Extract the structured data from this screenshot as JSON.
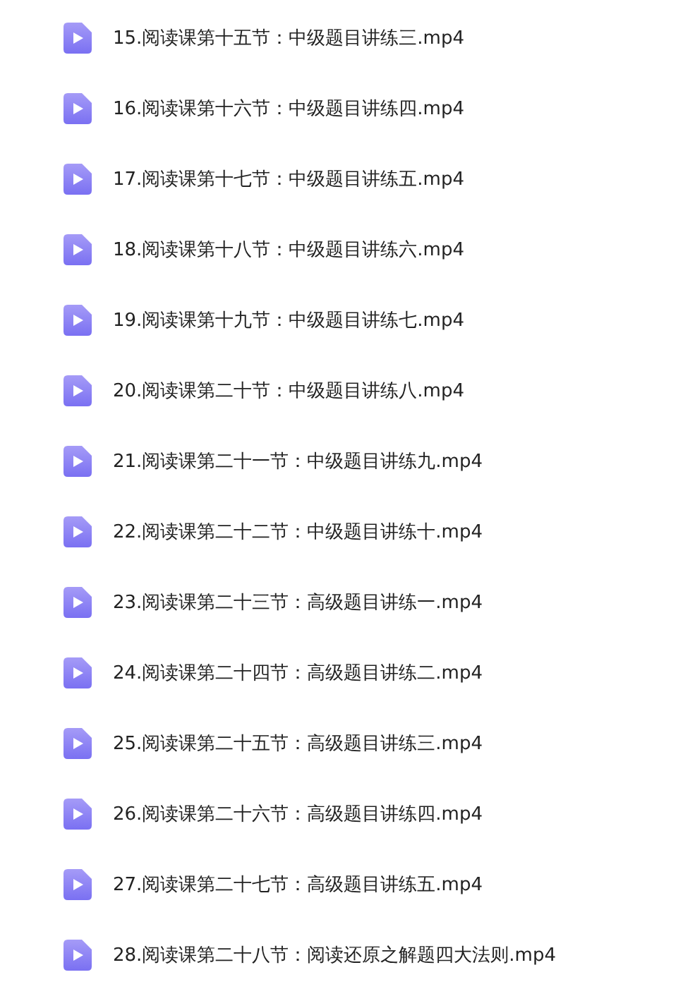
{
  "files": [
    {
      "name": "15.阅读课第十五节：中级题目讲练三.mp4"
    },
    {
      "name": "16.阅读课第十六节：中级题目讲练四.mp4"
    },
    {
      "name": "17.阅读课第十七节：中级题目讲练五.mp4"
    },
    {
      "name": "18.阅读课第十八节：中级题目讲练六.mp4"
    },
    {
      "name": "19.阅读课第十九节：中级题目讲练七.mp4"
    },
    {
      "name": "20.阅读课第二十节：中级题目讲练八.mp4"
    },
    {
      "name": "21.阅读课第二十一节：中级题目讲练九.mp4"
    },
    {
      "name": "22.阅读课第二十二节：中级题目讲练十.mp4"
    },
    {
      "name": "23.阅读课第二十三节：高级题目讲练一.mp4"
    },
    {
      "name": "24.阅读课第二十四节：高级题目讲练二.mp4"
    },
    {
      "name": "25.阅读课第二十五节：高级题目讲练三.mp4"
    },
    {
      "name": "26.阅读课第二十六节：高级题目讲练四.mp4"
    },
    {
      "name": "27.阅读课第二十七节：高级题目讲练五.mp4"
    },
    {
      "name": "28.阅读课第二十八节：阅读还原之解题四大法则.mp4"
    }
  ]
}
